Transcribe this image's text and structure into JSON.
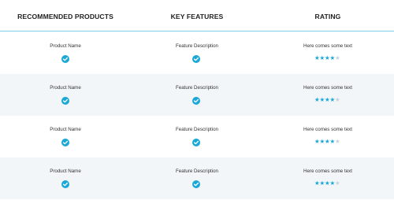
{
  "colors": {
    "accent": "#1aa8d6",
    "header_rule": "#7dcde8",
    "alt_row": "#f3f6f9",
    "star_off": "#c9d1d6"
  },
  "headers": {
    "products": "RECOMMENDED PRODUCTS",
    "features": "KEY FEATURES",
    "rating": "RATING"
  },
  "rows": [
    {
      "product": "Product Name",
      "feature": "Feature Description",
      "rating_text": "Here comes some text",
      "stars": 4,
      "max_stars": 5,
      "product_icon": "check-circle-icon",
      "feature_icon": "check-circle-icon"
    },
    {
      "product": "Product Name",
      "feature": "Feature Description",
      "rating_text": "Here comes some text",
      "stars": 4,
      "max_stars": 5,
      "product_icon": "check-circle-icon",
      "feature_icon": "check-circle-icon"
    },
    {
      "product": "Product Name",
      "feature": "Feature Description",
      "rating_text": "Here comes some text",
      "stars": 4,
      "max_stars": 5,
      "product_icon": "check-circle-icon",
      "feature_icon": "check-circle-icon"
    },
    {
      "product": "Product Name",
      "feature": "Feature Description",
      "rating_text": "Here comes some text",
      "stars": 4,
      "max_stars": 5,
      "product_icon": "check-circle-icon",
      "feature_icon": "check-circle-icon"
    }
  ]
}
